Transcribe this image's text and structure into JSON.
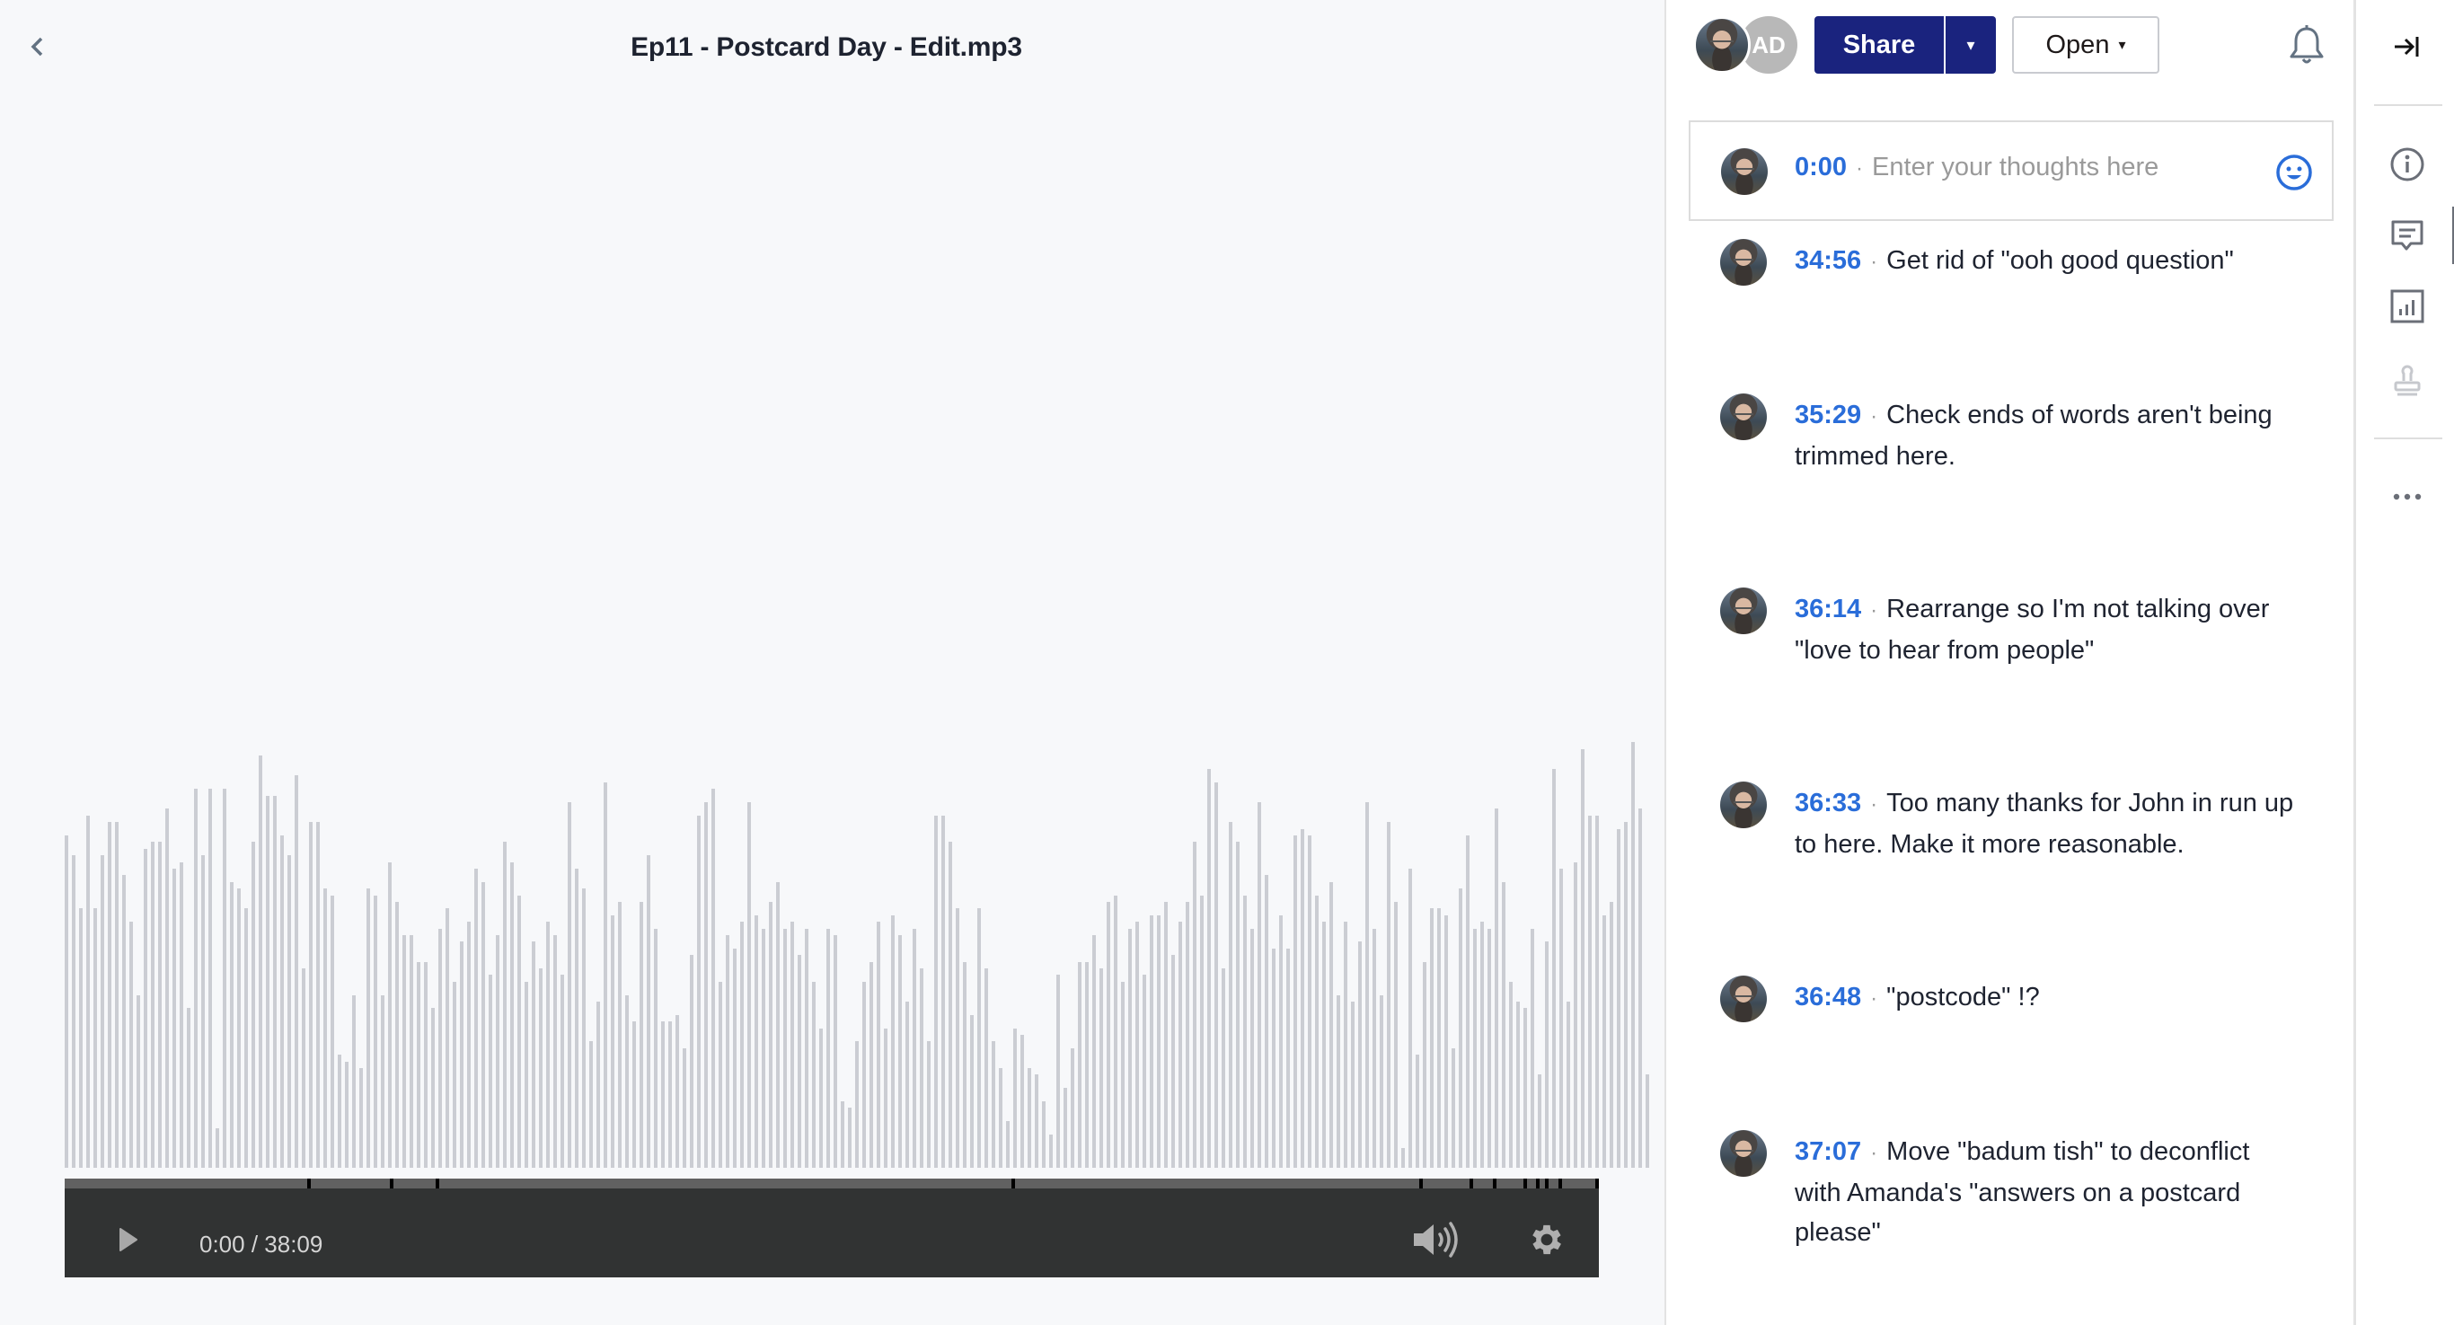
{
  "viewer": {
    "title": "Ep11 - Postcard Day - Edit.mp3",
    "back_icon": "chevron-left-icon",
    "waveform": {
      "bar_color": "#cbcdd3",
      "levels": [
        0.5,
        0.47,
        0.39,
        0.53,
        0.39,
        0.47,
        0.52,
        0.52,
        0.44,
        0.37,
        0.26,
        0.48,
        0.49,
        0.49,
        0.54,
        0.45,
        0.46,
        0.24,
        0.57,
        0.47,
        0.57,
        0.06,
        0.57,
        0.43,
        0.42,
        0.39,
        0.49,
        0.62,
        0.56,
        0.56,
        0.5,
        0.47,
        0.59,
        0.3,
        0.52,
        0.52,
        0.42,
        0.41,
        0.17,
        0.16,
        0.26,
        0.15,
        0.42,
        0.41,
        0.26,
        0.46,
        0.4,
        0.35,
        0.35,
        0.31,
        0.31,
        0.24,
        0.36,
        0.39,
        0.28,
        0.34,
        0.37,
        0.45,
        0.43,
        0.29,
        0.35,
        0.49,
        0.46,
        0.41,
        0.28,
        0.34,
        0.3,
        0.37,
        0.35,
        0.29,
        0.55,
        0.45,
        0.42,
        0.19,
        0.25,
        0.58,
        0.38,
        0.4,
        0.26,
        0.22,
        0.4,
        0.47,
        0.36,
        0.22,
        0.22,
        0.23,
        0.18,
        0.32,
        0.53,
        0.55,
        0.57,
        0.28,
        0.35,
        0.33,
        0.37,
        0.55,
        0.38,
        0.36,
        0.4,
        0.43,
        0.36,
        0.37,
        0.32,
        0.36,
        0.28,
        0.21,
        0.36,
        0.35,
        0.1,
        0.09,
        0.19,
        0.28,
        0.31,
        0.37,
        0.21,
        0.38,
        0.35,
        0.25,
        0.36,
        0.3,
        0.19,
        0.53,
        0.53,
        0.49,
        0.39,
        0.31,
        0.23,
        0.39,
        0.3,
        0.19,
        0.15,
        0.07,
        0.21,
        0.2,
        0.15,
        0.14,
        0.1,
        0.05,
        0.29,
        0.12,
        0.18,
        0.31,
        0.31,
        0.35,
        0.3,
        0.4,
        0.41,
        0.28,
        0.36,
        0.37,
        0.29,
        0.38,
        0.38,
        0.4,
        0.32,
        0.37,
        0.4,
        0.49,
        0.41,
        0.6,
        0.58,
        0.3,
        0.52,
        0.49,
        0.41,
        0.36,
        0.55,
        0.44,
        0.33,
        0.38,
        0.33,
        0.5,
        0.51,
        0.5,
        0.41,
        0.37,
        0.43,
        0.26,
        0.37,
        0.25,
        0.34,
        0.55,
        0.36,
        0.26,
        0.52,
        0.4,
        0.03,
        0.45,
        0.17,
        0.31,
        0.39,
        0.39,
        0.38,
        0.18,
        0.42,
        0.5,
        0.36,
        0.37,
        0.36,
        0.54,
        0.43,
        0.28,
        0.25,
        0.24,
        0.36,
        0.14,
        0.34,
        0.6,
        0.45,
        0.25,
        0.46,
        0.63,
        0.53,
        0.53,
        0.38,
        0.4,
        0.51,
        0.52,
        0.64,
        0.54,
        0.14
      ]
    }
  },
  "player": {
    "current_time": "0:00",
    "separator": "/",
    "duration": "38:09",
    "time_display": "0:00 / 38:09",
    "progress": 0.0,
    "comment_markers": [
      0.159,
      0.213,
      0.243,
      0.618,
      0.884,
      0.917,
      0.932,
      0.952,
      0.96,
      0.966,
      0.975,
      0.999
    ],
    "icons": {
      "play": "play-icon",
      "volume": "volume-icon",
      "settings": "gear-icon"
    }
  },
  "header": {
    "collaborators": [
      {
        "type": "photo",
        "label": "User avatar"
      },
      {
        "type": "initials",
        "initials": "AD"
      }
    ],
    "share_label": "Share",
    "share_caret": "▾",
    "open_label": "Open",
    "open_caret": "▾",
    "bell_icon": "bell-icon"
  },
  "comment_input": {
    "timestamp": "0:00",
    "separator": "·",
    "placeholder": "Enter your thoughts here",
    "value": "",
    "emoji_icon": "smiley-icon"
  },
  "comments": [
    {
      "timestamp": "34:56",
      "separator": "·",
      "text": "Get rid of \"ooh good question\""
    },
    {
      "timestamp": "35:29",
      "separator": "·",
      "text": "Check ends of words aren't being trimmed here."
    },
    {
      "timestamp": "36:14",
      "separator": "·",
      "text": "Rearrange so I'm not talking over \"love to hear from people\""
    },
    {
      "timestamp": "36:33",
      "separator": "·",
      "text": "Too many thanks for John in run up to here. Make it more reasonable."
    },
    {
      "timestamp": "36:48",
      "separator": "·",
      "text": "\"postcode\" !?"
    },
    {
      "timestamp": "37:07",
      "separator": "·",
      "text": "Move \"badum tish\" to  deconflict with Amanda's \"answers on a postcard please\""
    }
  ],
  "rail": {
    "items": [
      {
        "icon": "collapse-panel-icon"
      },
      {
        "icon": "info-icon"
      },
      {
        "icon": "comment-icon",
        "active": true
      },
      {
        "icon": "activity-chart-icon"
      },
      {
        "icon": "stamp-icon",
        "disabled": true
      },
      {
        "icon": "more-icon"
      }
    ]
  },
  "colors": {
    "brand_navy": "#1a237e",
    "timestamp_blue": "#2a6dd9",
    "player_bg": "#313333",
    "track": "#616161",
    "marker": "#000000",
    "viewer_bg": "#f7f8fa"
  }
}
